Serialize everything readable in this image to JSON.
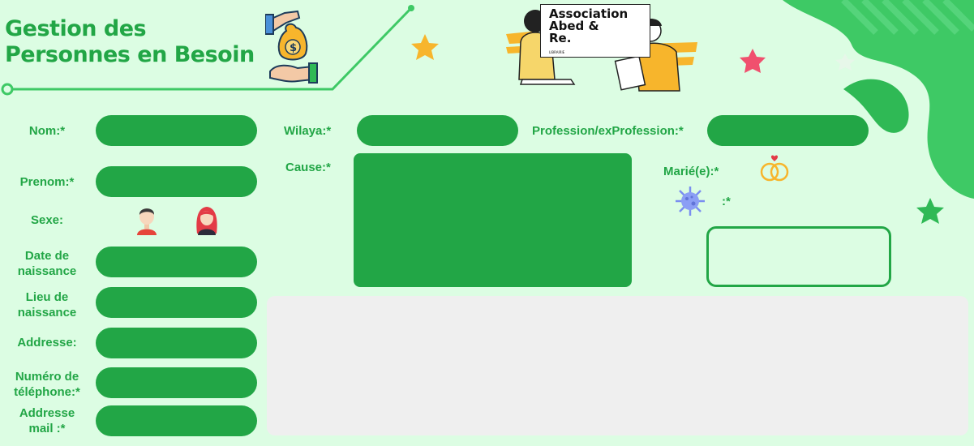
{
  "header": {
    "title_line1": "Gestion des",
    "title_line2": "Personnes en Besoin",
    "money_icon": "hand-money-bag-icon",
    "logo": {
      "line1": "Association",
      "line2": "Abed &",
      "line3": "Re.",
      "tagline": "LIBRAIRIE"
    }
  },
  "form": {
    "nom_label": "Nom:*",
    "prenom_label": "Prenom:*",
    "sexe_label": "Sexe:",
    "date_label": "Date de naissance",
    "lieu_label": "Lieu de naissance",
    "adresse_label": "Addresse:",
    "telephone_label": "Numéro de téléphone:*",
    "email_label": "Addresse mail :*",
    "wilaya_label": "Wilaya:*",
    "profession_label": "Profession/exProfession:*",
    "cause_label": "Cause:*",
    "marie_label": "Marié(e):*",
    "virus_label": ":*"
  },
  "icons": {
    "male": "male-avatar-icon",
    "female": "female-avatar-icon",
    "rings": "wedding-rings-icon",
    "virus": "virus-icon"
  },
  "colors": {
    "brand_green": "#22a646",
    "background": "#dcfde3",
    "panel_gray": "#efefef",
    "star_orange": "#f7b52c",
    "star_red": "#f0506e"
  }
}
